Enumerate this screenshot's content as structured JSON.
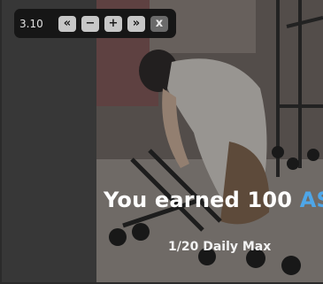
{
  "player": {
    "speed": "3.10",
    "buttons": [
      {
        "id": "rewind",
        "glyph": "«"
      },
      {
        "id": "slower",
        "glyph": "−"
      },
      {
        "id": "faster",
        "glyph": "+"
      },
      {
        "id": "fast_forward",
        "glyph": "»"
      },
      {
        "id": "close",
        "glyph": "x"
      }
    ]
  },
  "reward": {
    "earned_prefix": "You earned 100 ",
    "currency": "AS",
    "daily_progress": "1/20 Daily Max"
  },
  "colors": {
    "accent": "#4ea6e8",
    "panel": "#373737",
    "toolbar": "#161616"
  }
}
